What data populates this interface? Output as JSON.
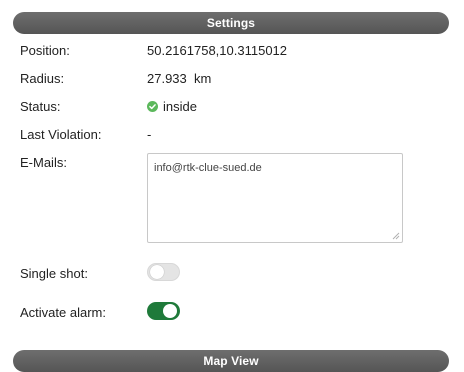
{
  "settings_header": "Settings",
  "map_view_header": "Map View",
  "rows": {
    "position": {
      "label": "Position:",
      "value": "50.2161758,10.3115012"
    },
    "radius": {
      "label": "Radius:",
      "value": "27.933  km"
    },
    "status": {
      "label": "Status:",
      "value": "inside",
      "icon": "check-circle-icon",
      "icon_color": "#5cb85c"
    },
    "last_violation": {
      "label": "Last Violation:",
      "value": "-"
    },
    "emails": {
      "label": "E-Mails:",
      "value": "info@rtk-clue-sued.de"
    },
    "single_shot": {
      "label": "Single shot:",
      "enabled": false
    },
    "activate_alarm": {
      "label": "Activate alarm:",
      "enabled": true
    }
  },
  "colors": {
    "header_bg": "#5f5f5f",
    "toggle_on": "#1f7a3a",
    "toggle_off": "#e4e4e4",
    "status_ok": "#5cb85c"
  }
}
